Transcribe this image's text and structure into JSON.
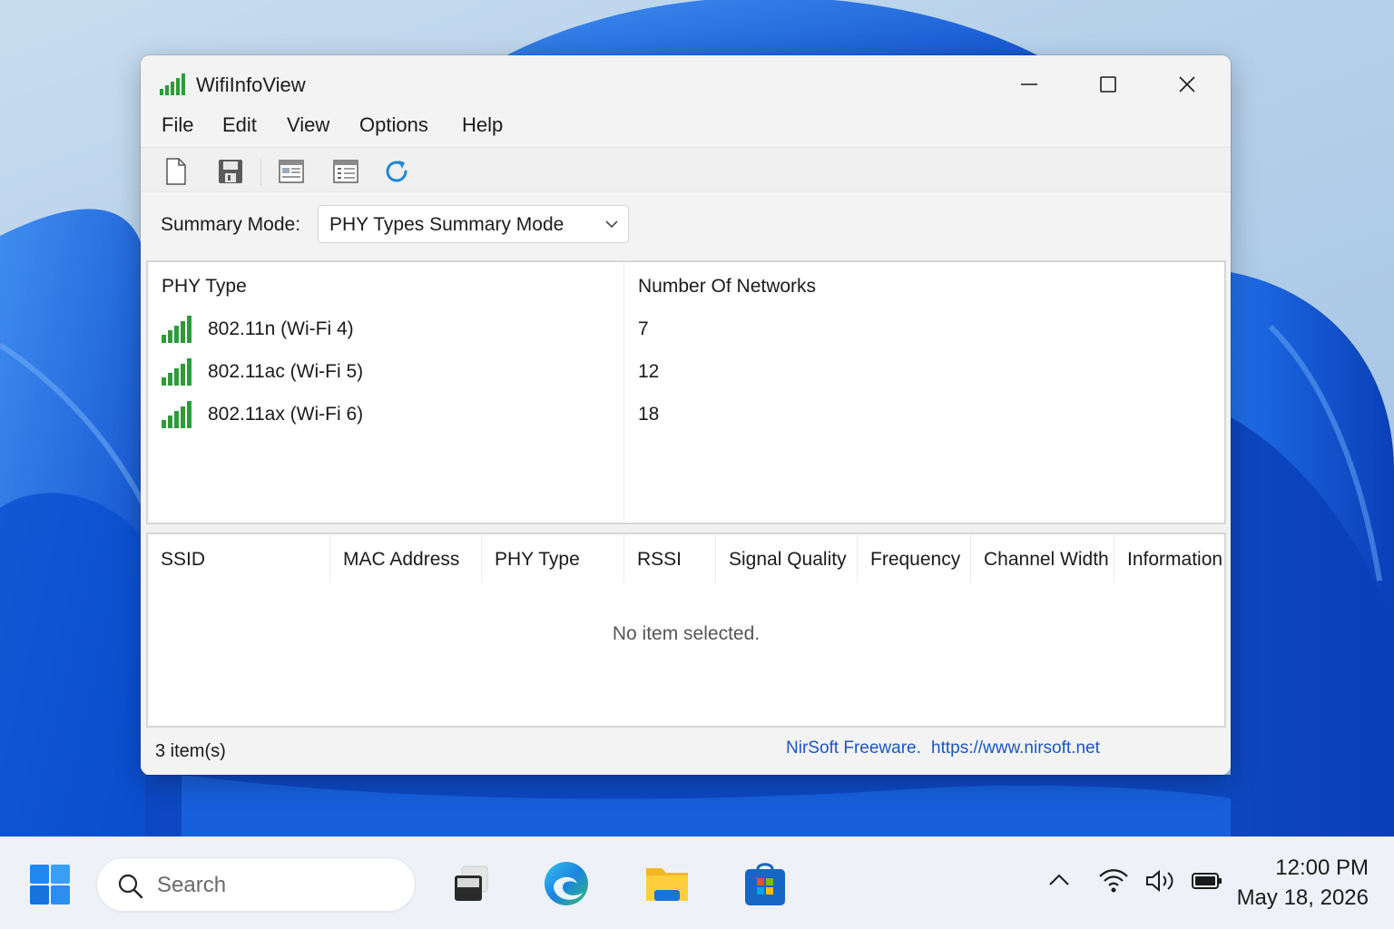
{
  "window": {
    "title": "WifiInfoView",
    "controls": {
      "minimize": "minimize",
      "maximize": "maximize",
      "close": "close"
    }
  },
  "menu": [
    "File",
    "Edit",
    "View",
    "Options",
    "Help"
  ],
  "toolbar": {
    "icons": [
      "new-file-icon",
      "save-icon",
      "html-report-icon",
      "properties-icon",
      "refresh-icon"
    ]
  },
  "summary": {
    "label": "Summary Mode:",
    "selected": "PHY Types Summary Mode"
  },
  "summary_table": {
    "columns": [
      "PHY Type",
      "Number Of Networks"
    ],
    "rows": [
      {
        "phy_type": "802.11n (Wi-Fi 4)",
        "count": "7"
      },
      {
        "phy_type": "802.11ac (Wi-Fi 5)",
        "count": "12"
      },
      {
        "phy_type": "802.11ax (Wi-Fi 6)",
        "count": "18"
      }
    ]
  },
  "detail_table": {
    "columns": [
      "SSID",
      "MAC Address",
      "PHY Type",
      "RSSI",
      "Signal Quality",
      "Frequency",
      "Channel Width",
      "Information"
    ],
    "empty_message": "No item selected."
  },
  "status": {
    "count": "3 item(s)",
    "link_text": "NirSoft Freeware.",
    "url": "https://www.nirsoft.net"
  },
  "taskbar": {
    "search_placeholder": "Search",
    "apps": [
      "task-view-icon",
      "edge-icon",
      "file-explorer-icon",
      "store-icon"
    ],
    "tray": [
      "show-hidden-icons-chevron",
      "wifi-icon",
      "volume-icon",
      "battery-icon"
    ],
    "time": "12:00 PM",
    "date": "May 18, 2026"
  },
  "colors": {
    "accent_link": "#1a55c4",
    "signal_green": "#2e9b3a",
    "windows_blue": "#0f6cd6"
  }
}
